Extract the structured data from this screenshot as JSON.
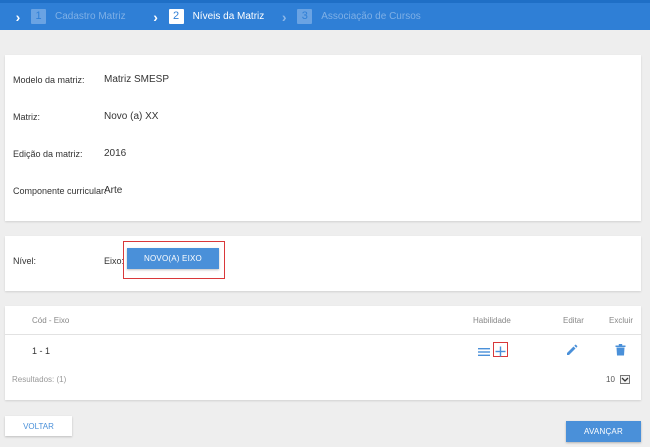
{
  "stepper": {
    "steps": [
      {
        "number": "1",
        "label": "Cadastro Matriz"
      },
      {
        "number": "2",
        "label": "Níveis da Matriz"
      },
      {
        "number": "3",
        "label": "Associação de Cursos"
      }
    ]
  },
  "info": {
    "modelo_label": "Modelo da matriz:",
    "modelo_value": "Matriz SMESP",
    "matriz_label": "Matriz:",
    "matriz_value": "Novo (a) XX",
    "edicao_label": "Edição da matriz:",
    "edicao_value": "2016",
    "componente_label": "Componente curricular:",
    "componente_value": "Arte"
  },
  "nivel": {
    "label": "Nível:",
    "eixo_label": "Eixo:",
    "novo_eixo_button": "NOVO(A) EIXO"
  },
  "table": {
    "headers": {
      "cod_eixo": "Cód - Eixo",
      "habilidade": "Habilidade",
      "editar": "Editar",
      "excluir": "Excluir"
    },
    "rows": [
      {
        "cod_eixo": "1 - 1"
      }
    ],
    "results_label": "Resultados: (1)",
    "page_size": "10"
  },
  "footer": {
    "voltar": "VOLTAR",
    "avancar": "AVANÇAR"
  },
  "colors": {
    "primary": "#4a90d9",
    "header": "#2f7fd6",
    "highlight": "#d9383a"
  }
}
